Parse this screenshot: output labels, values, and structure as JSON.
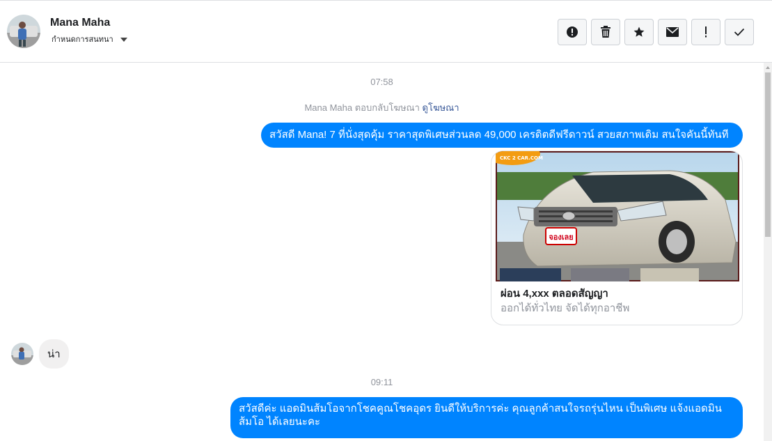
{
  "header": {
    "contact_name": "Mana Maha",
    "assign_label": "กำหนดการสนทนา",
    "actions": [
      {
        "icon": "alert-circle-icon",
        "name": "spam-button"
      },
      {
        "icon": "trash-icon",
        "name": "delete-button"
      },
      {
        "icon": "star-icon",
        "name": "star-button"
      },
      {
        "icon": "envelope-icon",
        "name": "mark-unread-button"
      },
      {
        "icon": "exclamation-icon",
        "name": "follow-up-button"
      },
      {
        "icon": "check-icon",
        "name": "mark-done-button"
      }
    ]
  },
  "thread": {
    "time_1": "07:58",
    "ad_reply_text": "Mana Maha ตอบกลับโฆษณา",
    "ad_link": "ดูโฆษณา",
    "message_1": "สวัสดี Mana! 7 ที่นั่งสุดคุ้ม ราคาสุดพิเศษส่วนลด 49,000 เครดิตดีฟรีดาวน์ สวยสภาพเดิม สนใจคันนี้ทันที",
    "card": {
      "image_badge": "จองเลย",
      "image_logo": "CKC 2 CAR.COM",
      "title": "ผ่อน 4,xxx ตลอดสัญญา",
      "subtitle": "ออกได้ทั่วไทย จัดได้ทุกอาชีพ"
    },
    "incoming_1": "น่า",
    "time_2": "09:11",
    "message_2_line1": "สวัสดีค่ะ แอดมินส้มโอจากโชคคูณโชคอุดร ยินดีให้บริการค่ะ   คุณลูกค้าสนใจรถรุ่นไหน เป็นพิเศษ แจ้งแอดมิน",
    "message_2_line2": "ส้มโอ ได้เลยนะคะ"
  },
  "colors": {
    "outgoing_bubble": "#0084ff",
    "incoming_bubble": "#f1f0f0",
    "link": "#385898",
    "muted": "#90949c"
  }
}
